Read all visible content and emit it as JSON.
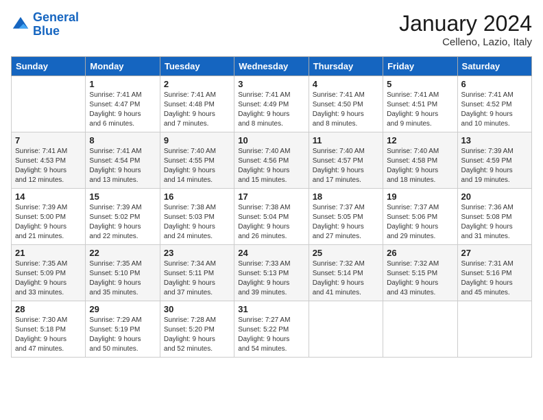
{
  "header": {
    "logo_line1": "General",
    "logo_line2": "Blue",
    "title": "January 2024",
    "subtitle": "Celleno, Lazio, Italy"
  },
  "days_of_week": [
    "Sunday",
    "Monday",
    "Tuesday",
    "Wednesday",
    "Thursday",
    "Friday",
    "Saturday"
  ],
  "weeks": [
    [
      {
        "day": "",
        "info": ""
      },
      {
        "day": "1",
        "info": "Sunrise: 7:41 AM\nSunset: 4:47 PM\nDaylight: 9 hours\nand 6 minutes."
      },
      {
        "day": "2",
        "info": "Sunrise: 7:41 AM\nSunset: 4:48 PM\nDaylight: 9 hours\nand 7 minutes."
      },
      {
        "day": "3",
        "info": "Sunrise: 7:41 AM\nSunset: 4:49 PM\nDaylight: 9 hours\nand 8 minutes."
      },
      {
        "day": "4",
        "info": "Sunrise: 7:41 AM\nSunset: 4:50 PM\nDaylight: 9 hours\nand 8 minutes."
      },
      {
        "day": "5",
        "info": "Sunrise: 7:41 AM\nSunset: 4:51 PM\nDaylight: 9 hours\nand 9 minutes."
      },
      {
        "day": "6",
        "info": "Sunrise: 7:41 AM\nSunset: 4:52 PM\nDaylight: 9 hours\nand 10 minutes."
      }
    ],
    [
      {
        "day": "7",
        "info": "Sunrise: 7:41 AM\nSunset: 4:53 PM\nDaylight: 9 hours\nand 12 minutes."
      },
      {
        "day": "8",
        "info": "Sunrise: 7:41 AM\nSunset: 4:54 PM\nDaylight: 9 hours\nand 13 minutes."
      },
      {
        "day": "9",
        "info": "Sunrise: 7:40 AM\nSunset: 4:55 PM\nDaylight: 9 hours\nand 14 minutes."
      },
      {
        "day": "10",
        "info": "Sunrise: 7:40 AM\nSunset: 4:56 PM\nDaylight: 9 hours\nand 15 minutes."
      },
      {
        "day": "11",
        "info": "Sunrise: 7:40 AM\nSunset: 4:57 PM\nDaylight: 9 hours\nand 17 minutes."
      },
      {
        "day": "12",
        "info": "Sunrise: 7:40 AM\nSunset: 4:58 PM\nDaylight: 9 hours\nand 18 minutes."
      },
      {
        "day": "13",
        "info": "Sunrise: 7:39 AM\nSunset: 4:59 PM\nDaylight: 9 hours\nand 19 minutes."
      }
    ],
    [
      {
        "day": "14",
        "info": "Sunrise: 7:39 AM\nSunset: 5:00 PM\nDaylight: 9 hours\nand 21 minutes."
      },
      {
        "day": "15",
        "info": "Sunrise: 7:39 AM\nSunset: 5:02 PM\nDaylight: 9 hours\nand 22 minutes."
      },
      {
        "day": "16",
        "info": "Sunrise: 7:38 AM\nSunset: 5:03 PM\nDaylight: 9 hours\nand 24 minutes."
      },
      {
        "day": "17",
        "info": "Sunrise: 7:38 AM\nSunset: 5:04 PM\nDaylight: 9 hours\nand 26 minutes."
      },
      {
        "day": "18",
        "info": "Sunrise: 7:37 AM\nSunset: 5:05 PM\nDaylight: 9 hours\nand 27 minutes."
      },
      {
        "day": "19",
        "info": "Sunrise: 7:37 AM\nSunset: 5:06 PM\nDaylight: 9 hours\nand 29 minutes."
      },
      {
        "day": "20",
        "info": "Sunrise: 7:36 AM\nSunset: 5:08 PM\nDaylight: 9 hours\nand 31 minutes."
      }
    ],
    [
      {
        "day": "21",
        "info": "Sunrise: 7:35 AM\nSunset: 5:09 PM\nDaylight: 9 hours\nand 33 minutes."
      },
      {
        "day": "22",
        "info": "Sunrise: 7:35 AM\nSunset: 5:10 PM\nDaylight: 9 hours\nand 35 minutes."
      },
      {
        "day": "23",
        "info": "Sunrise: 7:34 AM\nSunset: 5:11 PM\nDaylight: 9 hours\nand 37 minutes."
      },
      {
        "day": "24",
        "info": "Sunrise: 7:33 AM\nSunset: 5:13 PM\nDaylight: 9 hours\nand 39 minutes."
      },
      {
        "day": "25",
        "info": "Sunrise: 7:32 AM\nSunset: 5:14 PM\nDaylight: 9 hours\nand 41 minutes."
      },
      {
        "day": "26",
        "info": "Sunrise: 7:32 AM\nSunset: 5:15 PM\nDaylight: 9 hours\nand 43 minutes."
      },
      {
        "day": "27",
        "info": "Sunrise: 7:31 AM\nSunset: 5:16 PM\nDaylight: 9 hours\nand 45 minutes."
      }
    ],
    [
      {
        "day": "28",
        "info": "Sunrise: 7:30 AM\nSunset: 5:18 PM\nDaylight: 9 hours\nand 47 minutes."
      },
      {
        "day": "29",
        "info": "Sunrise: 7:29 AM\nSunset: 5:19 PM\nDaylight: 9 hours\nand 50 minutes."
      },
      {
        "day": "30",
        "info": "Sunrise: 7:28 AM\nSunset: 5:20 PM\nDaylight: 9 hours\nand 52 minutes."
      },
      {
        "day": "31",
        "info": "Sunrise: 7:27 AM\nSunset: 5:22 PM\nDaylight: 9 hours\nand 54 minutes."
      },
      {
        "day": "",
        "info": ""
      },
      {
        "day": "",
        "info": ""
      },
      {
        "day": "",
        "info": ""
      }
    ]
  ]
}
